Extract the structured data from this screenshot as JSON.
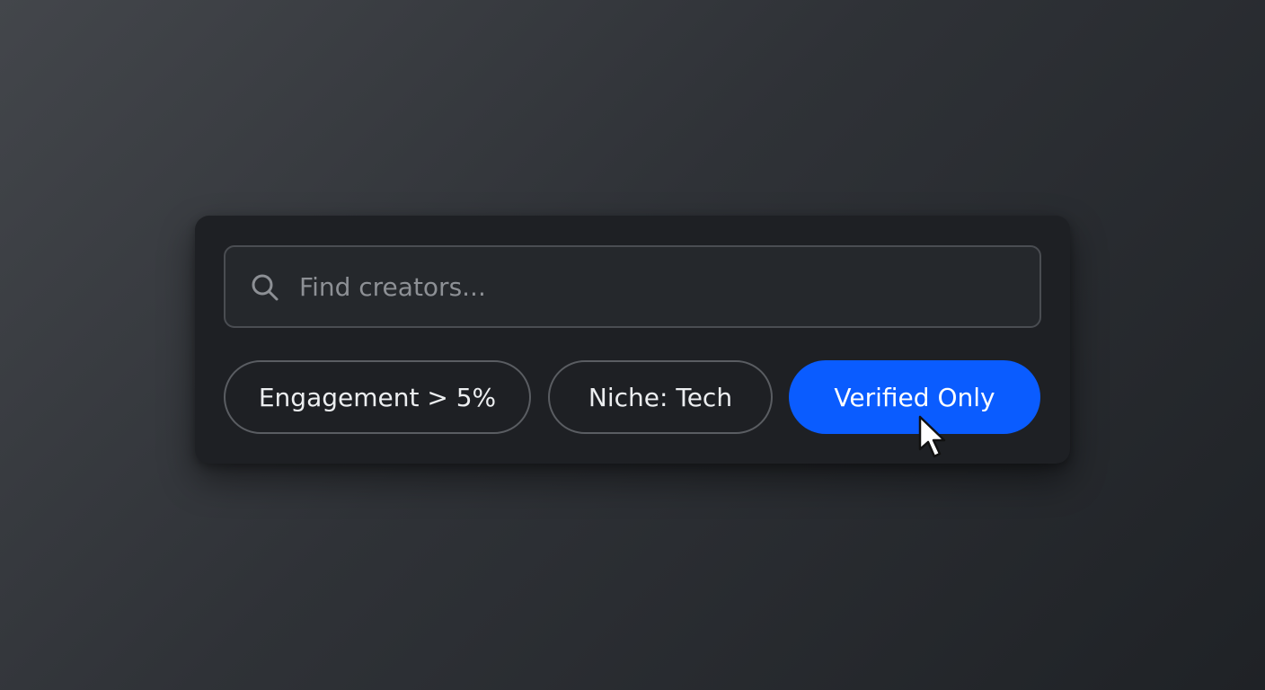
{
  "search": {
    "placeholder": "Find creators...",
    "icon": "search-icon"
  },
  "filters": [
    {
      "label": "Engagement > 5%",
      "active": false
    },
    {
      "label": "Niche: Tech",
      "active": false
    },
    {
      "label": "Verified Only",
      "active": true
    }
  ],
  "colors": {
    "accent": "#0a5cff",
    "panel": "#1e2024",
    "chip_border": "#5a5d62"
  },
  "cursor": {
    "icon": "mouse-pointer-icon"
  }
}
